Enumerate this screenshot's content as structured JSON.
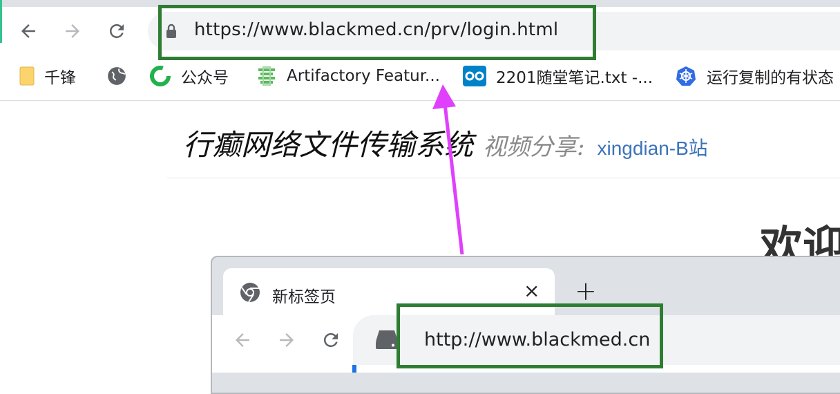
{
  "browser": {
    "url": "https://www.blackmed.cn/prv/login.html",
    "icons": {
      "back": "arrow-left-icon",
      "forward": "arrow-right-icon",
      "reload": "reload-icon",
      "lock": "lock-icon"
    }
  },
  "bookmarks": [
    {
      "label": "千锋",
      "icon": "folder-icon"
    },
    {
      "label": "",
      "icon": "globe-icon"
    },
    {
      "label": "公众号",
      "icon": "green-logo-icon"
    },
    {
      "label": "Artifactory Featur...",
      "icon": "artifactory-icon"
    },
    {
      "label": "2201随堂笔记.txt -...",
      "icon": "cloud-notes-icon"
    },
    {
      "label": "运行复制的有状态",
      "icon": "kubernetes-icon"
    }
  ],
  "page": {
    "title": "行癫网络文件传输系统",
    "subtitle": "视频分享:",
    "link": "xingdian-B站",
    "welcome": "欢迎"
  },
  "inset_browser": {
    "tab_title": "新标签页",
    "close": "×",
    "new_tab": "+",
    "url": "http://www.blackmed.cn"
  },
  "annotation": {
    "arrow_color": "#e040fb",
    "highlight_color": "#2e7d32"
  }
}
